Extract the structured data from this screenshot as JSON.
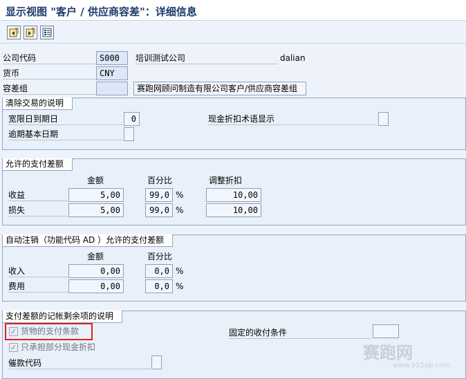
{
  "title": "显示视图 \"客户 / 供应商容差\"：详细信息",
  "toolbar": {
    "icons": [
      "prev-entry-icon",
      "next-entry-icon",
      "list-icon"
    ]
  },
  "header": {
    "company_code_label": "公司代码",
    "company_code_value": "S000",
    "company_name": "培训测试公司",
    "company_city": "dalian",
    "currency_label": "货币",
    "currency_value": "CNY",
    "tolerance_group_label": "容差组",
    "tolerance_group_value": "",
    "tolerance_group_desc": "赛跑网顾问制造有限公司客户/供应商容差组"
  },
  "clearing": {
    "title": "清除交易的说明",
    "grace_label": "宽限日到期日",
    "grace_value": "0",
    "cash_disc_label": "现金折扣术语显示",
    "arrears_label": "逾期基本日期"
  },
  "permitted": {
    "title": "允许的支付差额",
    "col_amount": "金额",
    "col_percent": "百分比",
    "col_adjust": "调整折扣",
    "rows": [
      {
        "label": "收益",
        "amount": "5,00",
        "percent": "99,0",
        "unit": "%",
        "adjust": "10,00"
      },
      {
        "label": "损失",
        "amount": "5,00",
        "percent": "99,0",
        "unit": "%",
        "adjust": "10,00"
      }
    ]
  },
  "auto_writeoff": {
    "title": "自动注销（功能代码 AD ）允许的支付差额",
    "col_amount": "金额",
    "col_percent": "百分比",
    "rows": [
      {
        "label": "收入",
        "amount": "0,00",
        "percent": "0,0",
        "unit": "%"
      },
      {
        "label": "费用",
        "amount": "0,00",
        "percent": "0,0",
        "unit": "%"
      }
    ]
  },
  "residual": {
    "title": "支付差额的记帐剩余项的说明",
    "terms_from_invoice_label": "货物的支付条款",
    "partial_cash_disc_label": "只承担部分现金折扣",
    "dunning_key_label": "催款代码",
    "fixed_terms_label": "固定的收付条件"
  },
  "watermark": {
    "text": "赛跑网",
    "url": "www.915ap.com"
  },
  "colors": {
    "title": "#1d3b6a",
    "highlight": "#e02020",
    "group_bg": "#e9f0f9",
    "field_bg": "#dde7f5"
  }
}
